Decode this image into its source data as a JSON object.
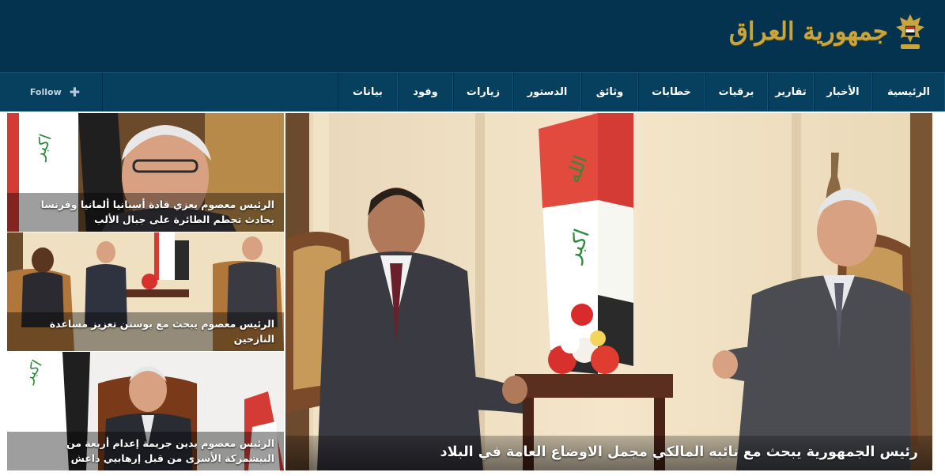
{
  "header": {
    "logo_text": "جمهورية العراق",
    "emblem_icon": "iraq-eagle-emblem-icon"
  },
  "nav": {
    "items": [
      {
        "label": "الرئيسية"
      },
      {
        "label": "الأخبار"
      },
      {
        "label": "تقارير"
      },
      {
        "label": "برقيات"
      },
      {
        "label": "خطابات"
      },
      {
        "label": "وثائق"
      },
      {
        "label": "الدستور"
      },
      {
        "label": "زيارات"
      },
      {
        "label": "وفود"
      },
      {
        "label": "بيانات"
      }
    ],
    "follow_label": "Follow",
    "follow_icon": "plus-icon"
  },
  "featured": {
    "caption": "رئيس الجمهورية يبحث مع نائبه المالكي مجمل الاوضاع العامة في البلاد"
  },
  "side_stories": [
    {
      "caption": "الرئيس معصوم يعزي قادة أسبانيا ألمانيا وفرنسا بحادث تحطم الطائرة على جبال الألب"
    },
    {
      "caption": "الرئيس معصوم يبحث مع بوستن تعزيز مساعدة النازحين"
    },
    {
      "caption": "الرئيس معصوم يدين جريمة إعدام أربعة من البيشمركة الأسرى من قبل إرهابيي داعش"
    }
  ],
  "colors": {
    "header_bg": "#03334f",
    "nav_bg": "#07405f",
    "logo_gold": "#c9a53c"
  }
}
